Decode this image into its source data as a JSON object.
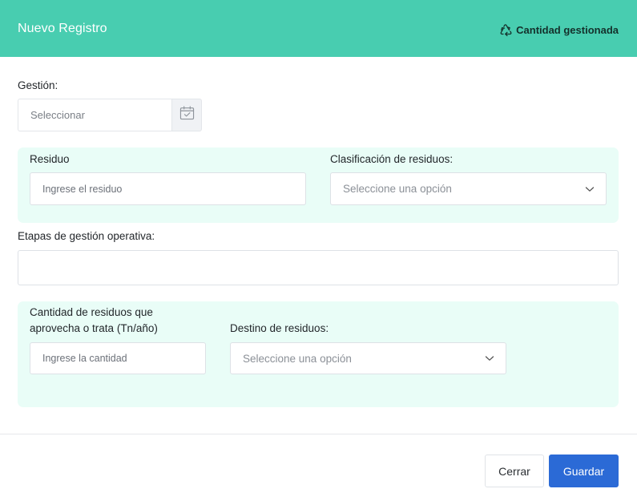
{
  "header": {
    "title": "Nuevo Registro",
    "right_label": "Cantidad gestionada",
    "right_icon": "recycle-icon"
  },
  "form": {
    "gestion": {
      "label": "Gestión:",
      "placeholder": "Seleccionar",
      "icon": "calendar-check-icon"
    },
    "residuo": {
      "label": "Residuo",
      "placeholder": "Ingrese el residuo"
    },
    "clasificacion": {
      "label": "Clasificación de residuos:",
      "selected": "Seleccione una opción"
    },
    "etapas": {
      "label": "Etapas de gestión operativa:",
      "value": ""
    },
    "cantidad": {
      "label_line1": "Cantidad de residuos que",
      "label_line2": "aprovecha o trata (Tn/año)",
      "placeholder": "Ingrese la cantidad"
    },
    "destino": {
      "label": "Destino de residuos:",
      "selected": "Seleccione una opción"
    }
  },
  "footer": {
    "close_label": "Cerrar",
    "save_label": "Guardar"
  },
  "colors": {
    "header_bg": "#48cdb0",
    "panel_bg": "#e9fdf7",
    "primary": "#2b6ad6"
  }
}
